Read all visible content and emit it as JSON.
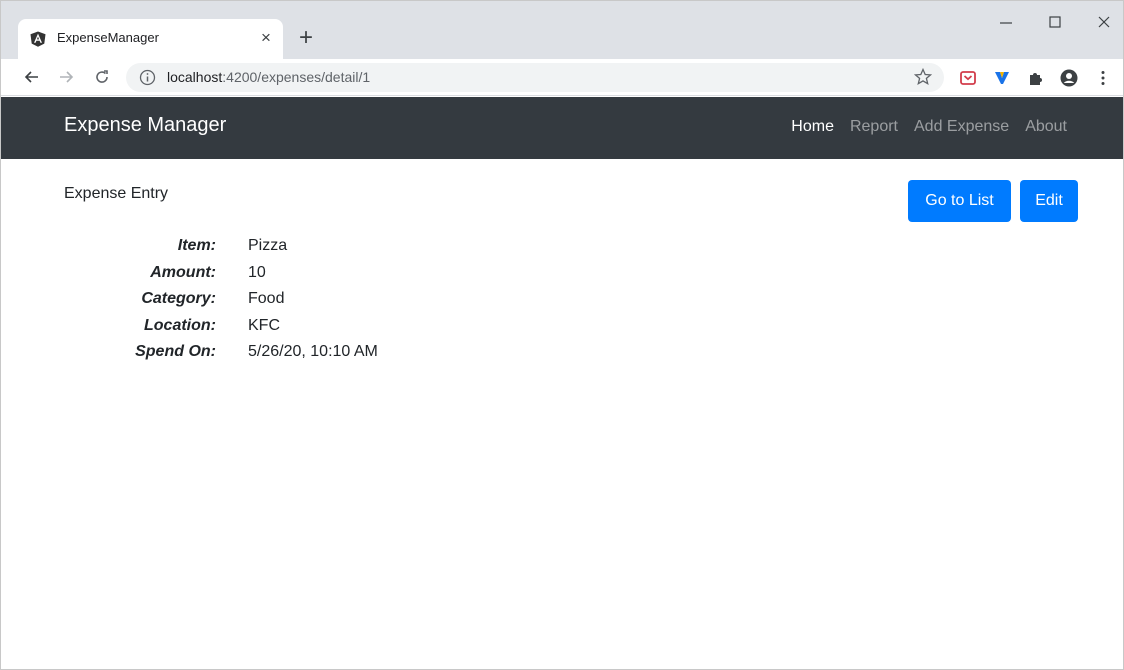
{
  "browser": {
    "tab": {
      "title": "ExpenseManager",
      "close_glyph": "×",
      "favicon": "angular-icon"
    },
    "new_tab_glyph": "+",
    "url": {
      "host": "localhost",
      "path": ":4200/expenses/detail/1"
    },
    "window_controls": [
      "minimize-icon",
      "maximize-icon",
      "close-icon"
    ],
    "extensions": [
      "pocket-icon",
      "v-extension-icon",
      "puzzle-icon",
      "profile-icon",
      "menu-dots-icon"
    ]
  },
  "navbar": {
    "brand": "Expense Manager",
    "links": [
      {
        "label": "Home",
        "active": true
      },
      {
        "label": "Report",
        "active": false
      },
      {
        "label": "Add Expense",
        "active": false
      },
      {
        "label": "About",
        "active": false
      }
    ]
  },
  "entry": {
    "title": "Expense Entry",
    "go_to_list_label": "Go to List",
    "edit_label": "Edit",
    "fields": [
      {
        "label": "Item:",
        "value": "Pizza"
      },
      {
        "label": "Amount:",
        "value": "10"
      },
      {
        "label": "Category:",
        "value": "Food"
      },
      {
        "label": "Location:",
        "value": "KFC"
      },
      {
        "label": "Spend On:",
        "value": "5/26/20, 10:10 AM"
      }
    ]
  },
  "colors": {
    "navbar_bg": "#343a40",
    "primary": "#007bff",
    "tabstrip_bg": "#dee1e6"
  }
}
